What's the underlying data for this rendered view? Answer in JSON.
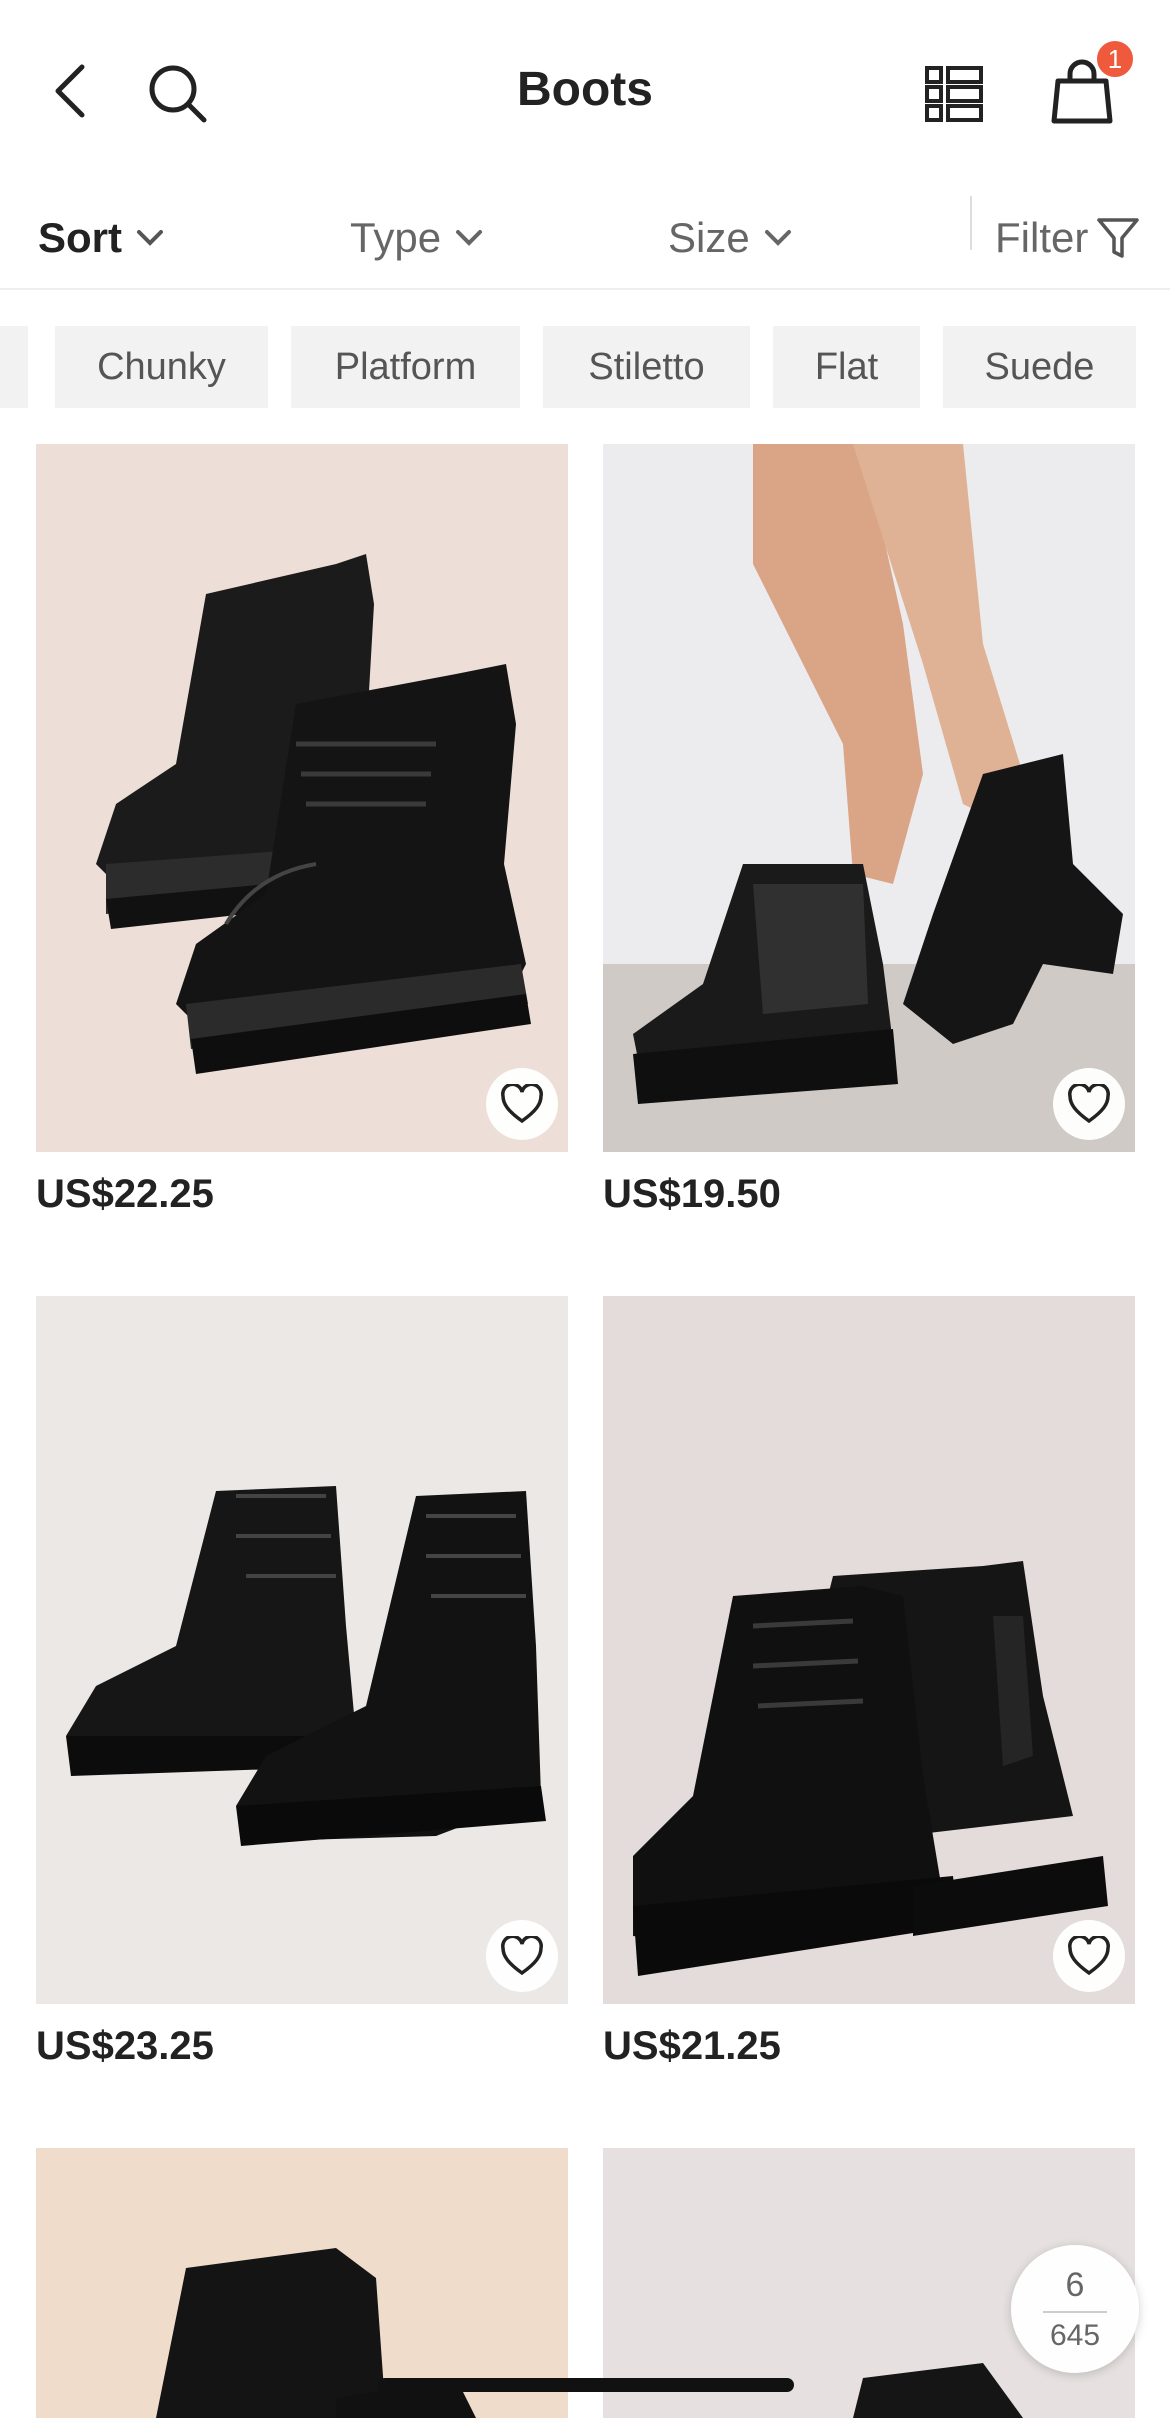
{
  "header": {
    "title": "Boots",
    "cart_count": "1",
    "icons": [
      "back-icon",
      "search-icon",
      "list-view-icon",
      "cart-icon"
    ]
  },
  "filterbar": {
    "sort_label": "Sort",
    "type_label": "Type",
    "size_label": "Size",
    "filter_label": "Filter"
  },
  "chips": [
    "Chunky",
    "Platform",
    "Stiletto",
    "Flat",
    "Suede"
  ],
  "products": [
    {
      "price": "US$22.25"
    },
    {
      "price": "US$19.50"
    },
    {
      "price": "US$23.25"
    },
    {
      "price": "US$21.25"
    }
  ],
  "pager": {
    "current": "6",
    "total": "645"
  },
  "colors": {
    "badge": "#f05a3c",
    "text": "#222222",
    "chip_bg": "#f2f2f2"
  }
}
